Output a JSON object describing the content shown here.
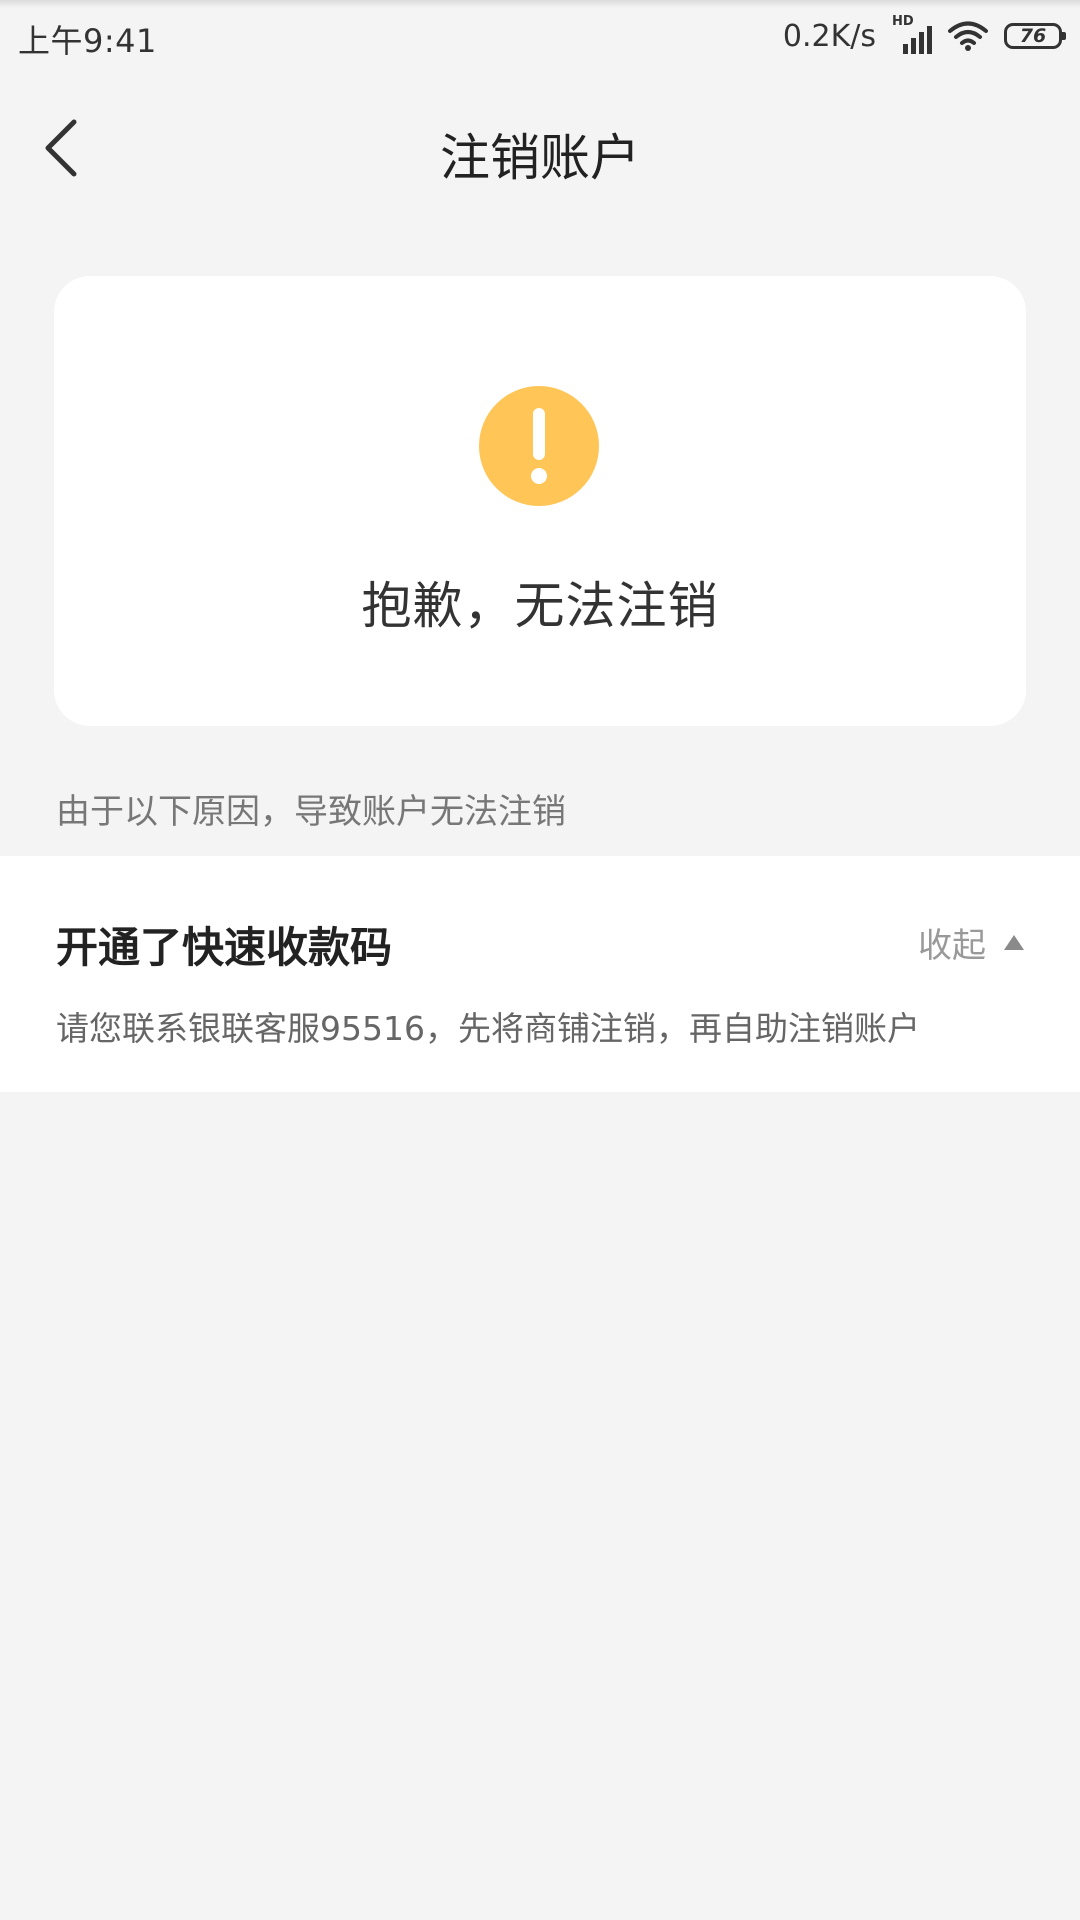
{
  "status_bar": {
    "time": "上午9:41",
    "net_speed": "0.2K/s",
    "network_type": "HD",
    "battery": "76"
  },
  "header": {
    "title": "注销账户",
    "back_icon": "chevron-left-icon"
  },
  "result_card": {
    "icon": "exclamation-circle-icon",
    "icon_color": "#FFC557",
    "title": "抱歉，无法注销"
  },
  "reason_hint": "由于以下原因，导致账户无法注销",
  "reasons": [
    {
      "title": "开通了快速收款码",
      "toggle_label": "收起",
      "description": "请您联系银联客服95516，先将商铺注销，再自助注销账户"
    }
  ]
}
